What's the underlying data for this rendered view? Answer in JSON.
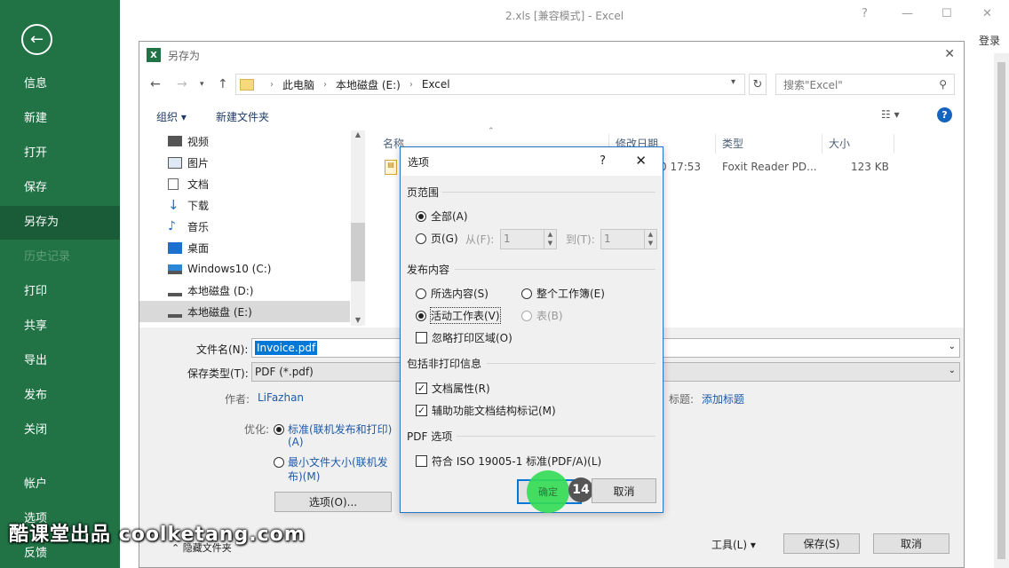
{
  "app": {
    "window_title": "2.xls  [兼容模式] - Excel",
    "login": "登录",
    "controls": {
      "help": "?",
      "minimize": "—",
      "restore": "☐",
      "close": "✕"
    }
  },
  "backstage": {
    "back_icon": "back-arrow-icon",
    "items": [
      {
        "label": "信息"
      },
      {
        "label": "新建"
      },
      {
        "label": "打开"
      },
      {
        "label": "保存"
      },
      {
        "label": "另存为"
      },
      {
        "label": "历史记录"
      },
      {
        "label": "打印"
      },
      {
        "label": "共享"
      },
      {
        "label": "导出"
      },
      {
        "label": "发布"
      },
      {
        "label": "关闭"
      },
      {
        "label": "帐户"
      },
      {
        "label": "选项"
      },
      {
        "label": "反馈"
      }
    ]
  },
  "saveas": {
    "title": "另存为",
    "address": [
      "此电脑",
      "本地磁盘 (E:)",
      "Excel"
    ],
    "search_placeholder": "搜索\"Excel\"",
    "organize": "组织 ▾",
    "new_folder": "新建文件夹",
    "tree": [
      {
        "label": "视频"
      },
      {
        "label": "图片"
      },
      {
        "label": "文档"
      },
      {
        "label": "下载"
      },
      {
        "label": "音乐"
      },
      {
        "label": "桌面"
      },
      {
        "label": "Windows10 (C:)"
      },
      {
        "label": "本地磁盘 (D:)"
      },
      {
        "label": "本地磁盘 (E:)"
      }
    ],
    "columns": {
      "name": "名称",
      "modified": "修改日期",
      "type": "类型",
      "size": "大小"
    },
    "file": {
      "modified": "0 17:53",
      "type": "Foxit Reader PD...",
      "size": "123 KB"
    },
    "filename_label": "文件名(N):",
    "filename_value": "Invoice.pdf",
    "filetype_label": "保存类型(T):",
    "filetype_value": "PDF (*.pdf)",
    "author_label": "作者:",
    "author_value": "LiFazhan",
    "tags_label": "标题:",
    "tags_value": "添加标题",
    "optimize_label": "优化:",
    "opt_standard": "标准(联机发布和打印)",
    "opt_standard_key": "(A)",
    "opt_min": "最小文件大小(联机发",
    "opt_min_2": "布)(M)",
    "options_button": "选项(O)...",
    "hide_folders": "隐藏文件夹",
    "tools_button": "工具(L)",
    "save_button": "保存(S)",
    "cancel_button": "取消"
  },
  "options_dialog": {
    "title": "选项",
    "help": "?",
    "page_range_group": "页范围",
    "all": "全部(A)",
    "pages": "页(G)",
    "from_label": "从(F):",
    "from_value": "1",
    "to_label": "到(T):",
    "to_value": "1",
    "publish_group": "发布内容",
    "selection": "所选内容(S)",
    "entire_workbook": "整个工作簿(E)",
    "active_sheet": "活动工作表(V)",
    "table": "表(B)",
    "ignore_print_area": "忽略打印区域(O)",
    "nonprint_group": "包括非打印信息",
    "doc_props": "文档属性(R)",
    "accessibility_tags": "辅助功能文档结构标记(M)",
    "pdf_group": "PDF 选项",
    "iso": "符合 ISO 19005-1 标准(PDF/A)(L)",
    "ok": "确定",
    "cancel": "取消"
  },
  "overlay": {
    "step": "14",
    "watermark": "酷课堂出品 coolketang.com"
  }
}
